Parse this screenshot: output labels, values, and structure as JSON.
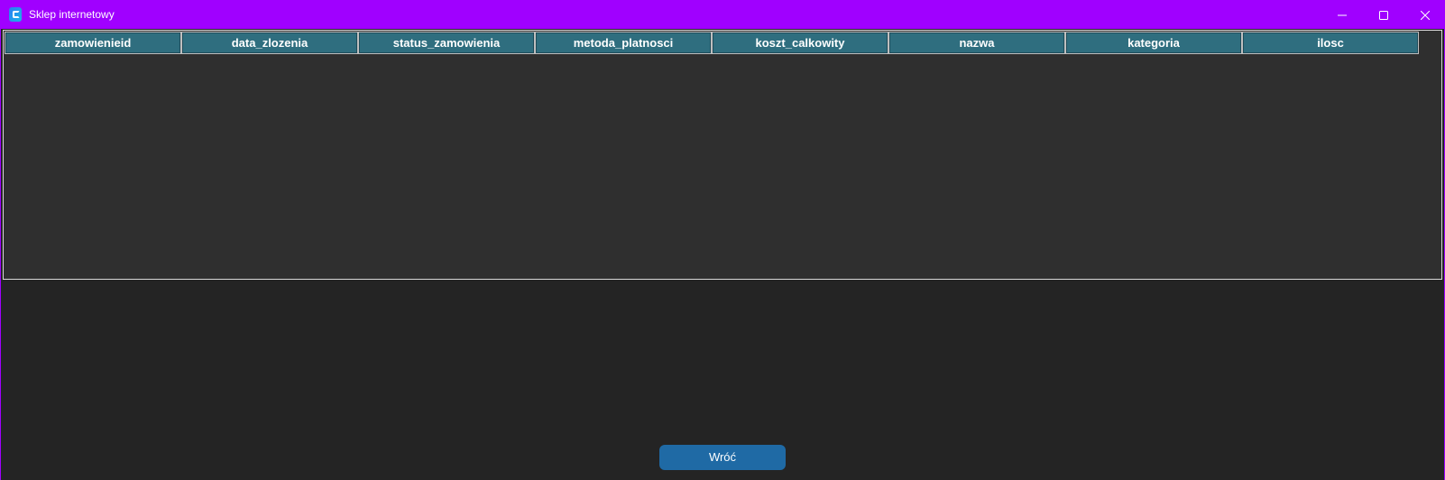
{
  "window": {
    "title": "Sklep internetowy",
    "title_bar_color": "#a000ff",
    "controls": {
      "minimize_icon": "minimize-icon",
      "maximize_icon": "maximize-icon",
      "close_icon": "close-icon"
    }
  },
  "table": {
    "columns": [
      "zamowienieid",
      "data_zlozenia",
      "status_zamowienia",
      "metoda_platnosci",
      "koszt_calkowity",
      "nazwa",
      "kategoria",
      "ilosc"
    ],
    "rows": [],
    "header_color": "#2f6e7f",
    "body_color": "#2f2f2f"
  },
  "footer": {
    "back_label": "Wróć",
    "back_color": "#1f6aa5"
  }
}
